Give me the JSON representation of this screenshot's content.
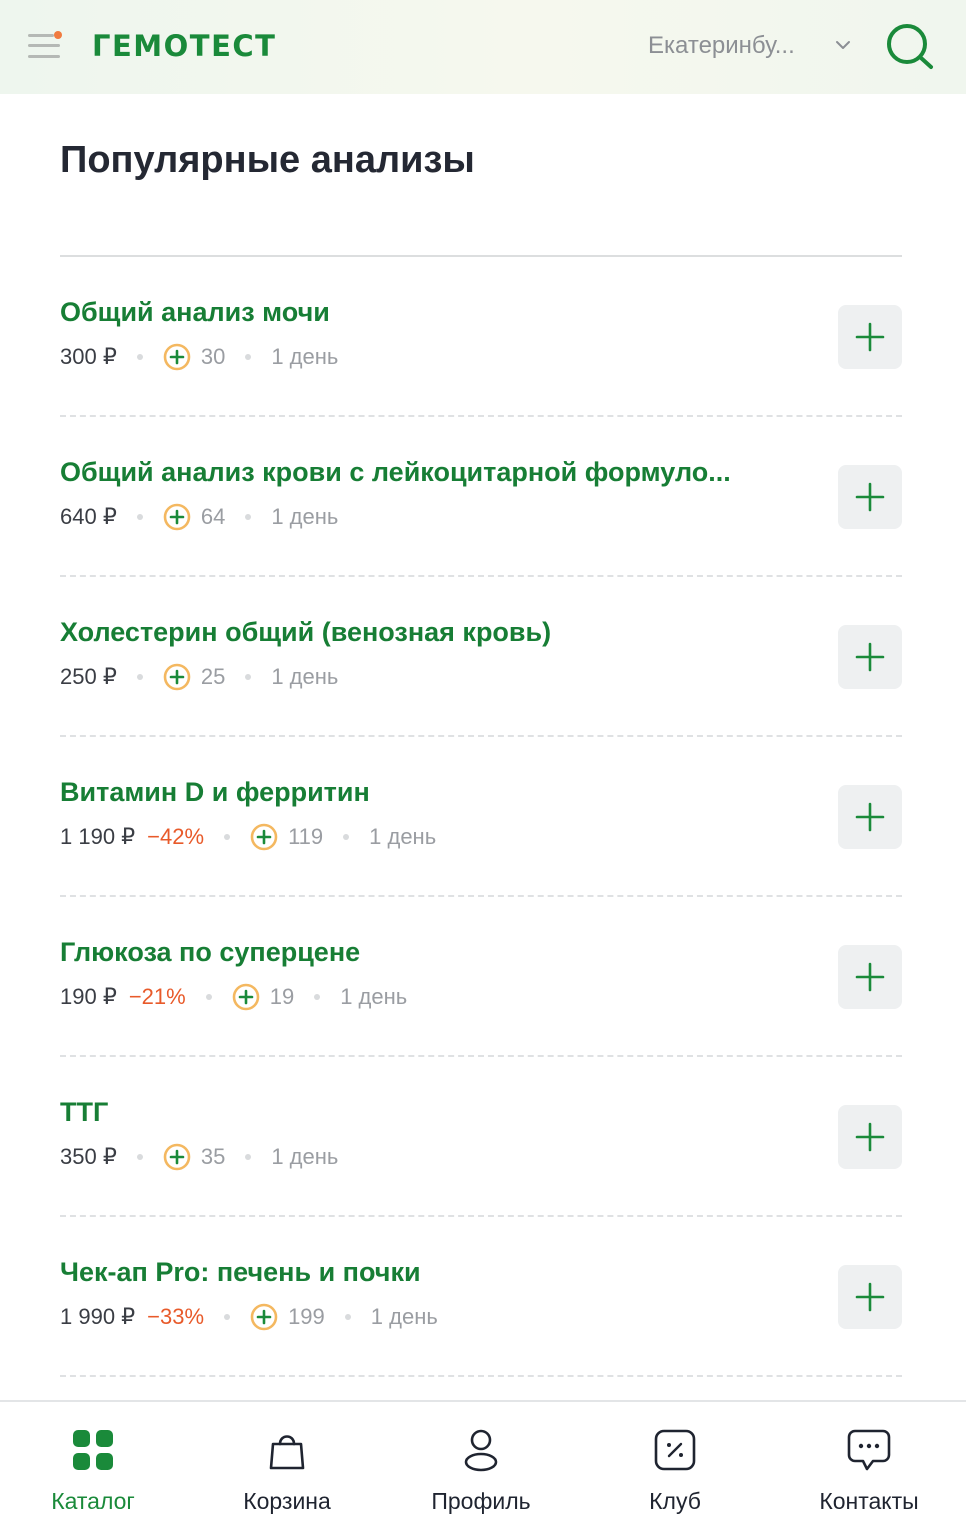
{
  "header": {
    "logo": "ГЕМОТЕСТ",
    "city": "Екатеринбу...",
    "icons": {
      "menu": "hamburger-menu-icon",
      "search": "search-icon",
      "city_arrow": "chevron-down-icon"
    },
    "colors": {
      "brand": "#1a8a3a",
      "notification_dot": "#f07b3f"
    }
  },
  "main": {
    "title": "Популярные анализы",
    "items": [
      {
        "name": "Общий анализ мочи",
        "price": "300 ₽",
        "discount": "",
        "bonus": "30",
        "days": "1 день"
      },
      {
        "name": "Общий анализ крови с лейкоцитарной формуло...",
        "price": "640 ₽",
        "discount": "",
        "bonus": "64",
        "days": "1 день"
      },
      {
        "name": "Холестерин общий (венозная кровь)",
        "price": "250 ₽",
        "discount": "",
        "bonus": "25",
        "days": "1 день"
      },
      {
        "name": "Витамин D и ферритин",
        "price": "1 190 ₽",
        "discount": "−42%",
        "bonus": "119",
        "days": "1 день"
      },
      {
        "name": "Глюкоза по суперцене",
        "price": "190 ₽",
        "discount": "−21%",
        "bonus": "19",
        "days": "1 день"
      },
      {
        "name": "ТТГ",
        "price": "350 ₽",
        "discount": "",
        "bonus": "35",
        "days": "1 день"
      },
      {
        "name": "Чек-ап Pro: печень и почки",
        "price": "1 990 ₽",
        "discount": "−33%",
        "bonus": "199",
        "days": "1 день"
      }
    ],
    "colors": {
      "item_title": "#177e35",
      "discount": "#e85a2a",
      "bonus_ring": "#f4b860"
    }
  },
  "tabbar": {
    "tabs": [
      {
        "label": "Каталог",
        "icon": "catalog-grid-icon",
        "active": true
      },
      {
        "label": "Корзина",
        "icon": "shopping-bag-icon",
        "active": false
      },
      {
        "label": "Профиль",
        "icon": "profile-icon",
        "active": false
      },
      {
        "label": "Клуб",
        "icon": "club-percent-icon",
        "active": false
      },
      {
        "label": "Контакты",
        "icon": "chat-bubble-icon",
        "active": false
      }
    ]
  }
}
